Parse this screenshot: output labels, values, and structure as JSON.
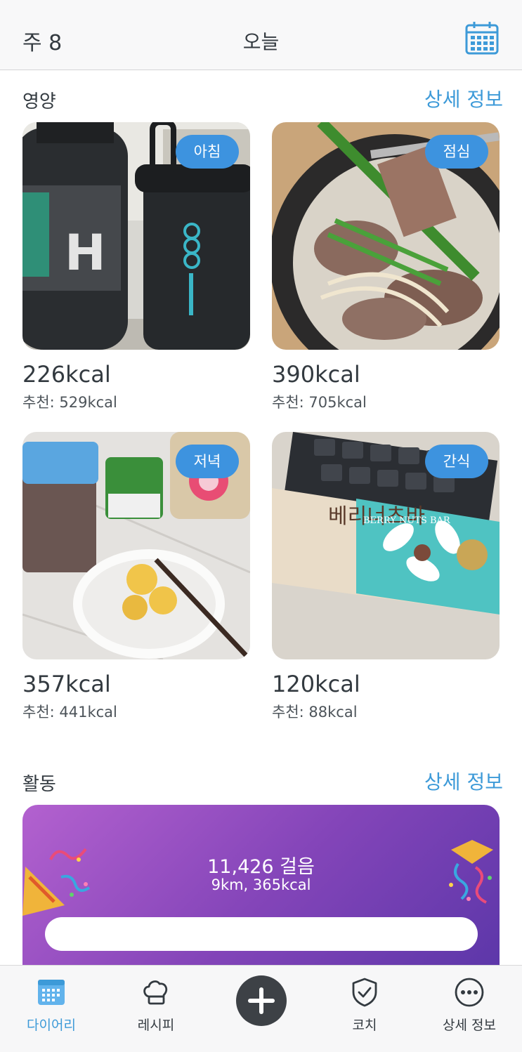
{
  "header": {
    "week": "주 8",
    "title": "오늘",
    "calendar_icon": "calendar-icon"
  },
  "nutrition": {
    "title": "영양",
    "detail_link": "상세 정보",
    "meals": [
      {
        "badge": "아침",
        "kcal": "226kcal",
        "recommended": "추천: 529kcal",
        "photo": "protein-shake-photo"
      },
      {
        "badge": "점심",
        "kcal": "390kcal",
        "recommended": "추천: 705kcal",
        "photo": "beef-soup-photo"
      },
      {
        "badge": "저녁",
        "kcal": "357kcal",
        "recommended": "추천: 441kcal",
        "photo": "sweet-potato-bowl-photo"
      },
      {
        "badge": "간식",
        "kcal": "120kcal",
        "recommended": "추천: 88kcal",
        "photo": "berry-nuts-bar-photo"
      }
    ]
  },
  "activity": {
    "title": "활동",
    "detail_link": "상세 정보",
    "steps": "11,426 걸음",
    "summary": "9km, 365kcal",
    "progress": 1.0
  },
  "tabbar": {
    "items": [
      {
        "label": "다이어리",
        "icon": "calendar-icon",
        "active": true
      },
      {
        "label": "레시피",
        "icon": "chef-hat-icon",
        "active": false
      },
      {
        "label": "",
        "icon": "plus-icon",
        "active": false
      },
      {
        "label": "코치",
        "icon": "shield-check-icon",
        "active": false
      },
      {
        "label": "상세 정보",
        "icon": "more-dots-icon",
        "active": false
      }
    ]
  },
  "colors": {
    "accent": "#3d9ad8",
    "badge": "#3d93df",
    "activity_gradient_start": "#b361cf",
    "activity_gradient_end": "#5a36a8"
  }
}
